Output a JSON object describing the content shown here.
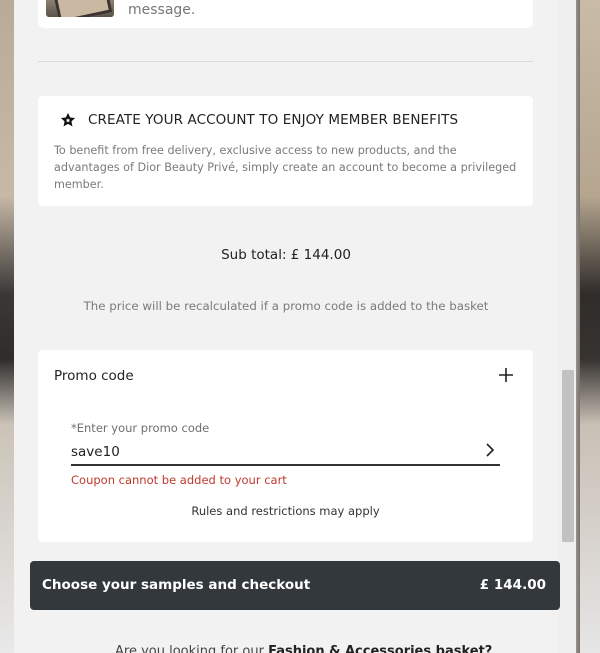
{
  "product_card": {
    "message_fragment": "message."
  },
  "member_benefits": {
    "title": "CREATE YOUR ACCOUNT TO ENJOY MEMBER BENEFITS",
    "text": "To benefit from free delivery, exclusive access to new products, and the advantages of Dior Beauty Privé, simply create an account to become a privileged member."
  },
  "summary": {
    "subtotal": "Sub total: £ 144.00",
    "recalc_note": "The price will be recalculated if a promo code is added to the basket"
  },
  "promo": {
    "title": "Promo code",
    "field_label": "*Enter your promo code",
    "field_value": "save10",
    "error": "Coupon cannot be added to your cart",
    "rules": "Rules and restrictions may apply"
  },
  "checkout": {
    "label": "Choose your samples and checkout",
    "price": "£ 144.00"
  },
  "bottom": {
    "partial_text": "Are you looking for our",
    "bold_text": "Fashion & Accessories basket?"
  },
  "colors": {
    "checkout_bg": "#33383c",
    "error": "#c0392b"
  }
}
